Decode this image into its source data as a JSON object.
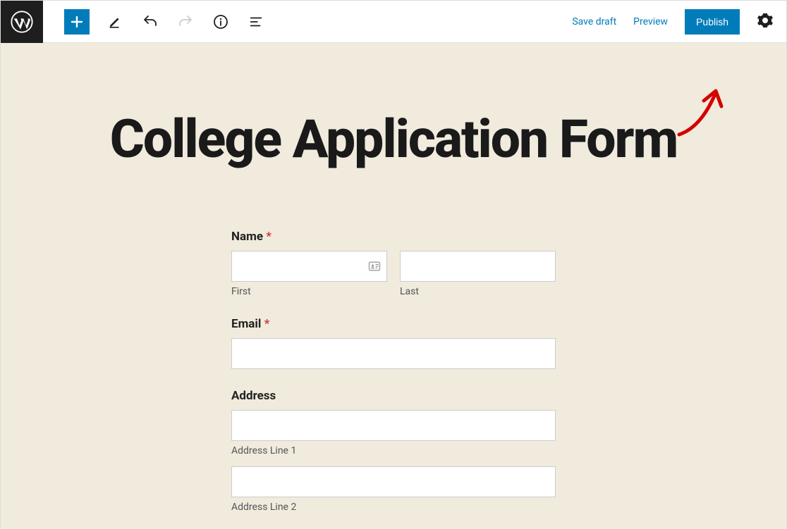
{
  "toolbar": {
    "save_draft": "Save draft",
    "preview": "Preview",
    "publish": "Publish"
  },
  "page": {
    "title": "College Application Form"
  },
  "form": {
    "name": {
      "label": "Name",
      "required": "*",
      "first_sublabel": "First",
      "last_sublabel": "Last"
    },
    "email": {
      "label": "Email",
      "required": "*"
    },
    "address": {
      "label": "Address",
      "line1_sublabel": "Address Line 1",
      "line2_sublabel": "Address Line 2"
    }
  }
}
